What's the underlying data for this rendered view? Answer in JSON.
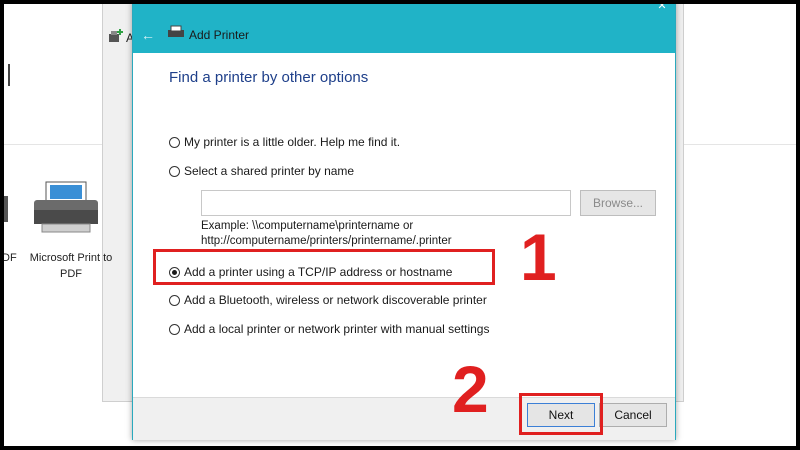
{
  "background": {
    "add_label": "A",
    "printer_label": "Microsoft Print to PDF",
    "left_label": "DF"
  },
  "dialog": {
    "title": "Add Printer",
    "heading": "Find a printer by other options",
    "options": [
      {
        "label": "My printer is a little older. Help me find it.",
        "checked": false
      },
      {
        "label": "Select a shared printer by name",
        "checked": false
      },
      {
        "label": "Add a printer using a TCP/IP address or hostname",
        "checked": true
      },
      {
        "label": "Add a Bluetooth, wireless or network discoverable printer",
        "checked": false
      },
      {
        "label": "Add a local printer or network printer with manual settings",
        "checked": false
      }
    ],
    "shared_name_value": "",
    "browse_label": "Browse...",
    "example_line1": "Example: \\\\computername\\printername or",
    "example_line2": "http://computername/printers/printername/.printer",
    "next_label": "Next",
    "cancel_label": "Cancel"
  },
  "annotations": {
    "step1": "1",
    "step2": "2",
    "highlight_color": "#e02020"
  },
  "colors": {
    "titlebar": "#20b3c7",
    "heading": "#1e3f8a"
  },
  "icons": [
    "back-arrow-icon",
    "printer-icon",
    "close-icon",
    "add-printer-icon"
  ]
}
